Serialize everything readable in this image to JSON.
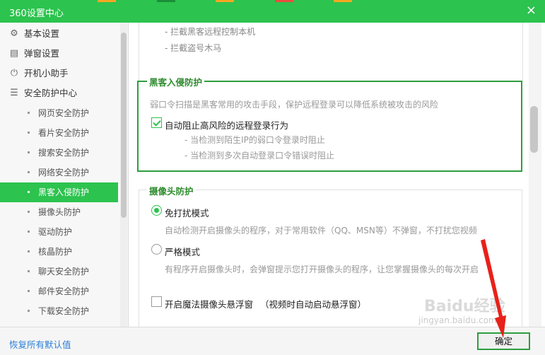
{
  "window": {
    "title": "360设置中心",
    "close_glyph": "×"
  },
  "colors": {
    "accent": "#2cc34e",
    "section_border": "#2e9e3e",
    "link": "#2c7fd6"
  },
  "sidebar": {
    "items": [
      {
        "label": "基本设置",
        "icon": "gear-icon",
        "glyph": "⚙"
      },
      {
        "label": "弹窗设置",
        "icon": "window-icon",
        "glyph": "▤"
      },
      {
        "label": "开机小助手",
        "icon": "power-icon",
        "glyph": "⏻"
      },
      {
        "label": "安全防护中心",
        "icon": "list-icon",
        "glyph": "☰"
      }
    ],
    "subitems": [
      {
        "label": "网页安全防护",
        "active": false
      },
      {
        "label": "看片安全防护",
        "active": false
      },
      {
        "label": "搜索安全防护",
        "active": false
      },
      {
        "label": "网络安全防护",
        "active": false
      },
      {
        "label": "黑客入侵防护",
        "active": true
      },
      {
        "label": "摄像头防护",
        "active": false
      },
      {
        "label": "驱动防护",
        "active": false
      },
      {
        "label": "核晶防护",
        "active": false
      },
      {
        "label": "聊天安全防护",
        "active": false
      },
      {
        "label": "邮件安全防护",
        "active": false
      },
      {
        "label": "下载安全防护",
        "active": false
      }
    ]
  },
  "content": {
    "prev_section": {
      "lines": [
        "- 拦截黑客远程控制本机",
        "- 拦截盗号木马"
      ]
    },
    "hacker": {
      "title": "黑客入侵防护",
      "desc": "弱口令扫描是黑客常用的攻击手段，保护远程登录可以降低系统被攻击的风险",
      "option": {
        "label": "自动阻止高风险的远程登录行为",
        "checked": true
      },
      "sub_lines": [
        "- 当检测到陌生IP的弱口令登录时阻止",
        "- 当检测到多次自动登录口令错误时阻止"
      ]
    },
    "camera": {
      "title": "摄像头防护",
      "mode1": {
        "label": "免打扰模式",
        "selected": true,
        "desc": "自动检测开启摄像头的程序，对于常用软件（QQ、MSN等）不弹窗，不打扰您视频"
      },
      "mode2": {
        "label": "严格模式",
        "selected": false,
        "desc": "有程序开启摄像头时，会弹窗提示您打开摄像头的程序，让您掌握摄像头的每次开启"
      },
      "magic": {
        "label": "开启魔法摄像头悬浮窗",
        "note": "（视频时自动启动悬浮窗）",
        "checked": false
      }
    }
  },
  "footer": {
    "restore": "恢复所有默认值",
    "ok": "确定"
  },
  "watermark": {
    "main": "Baidu经验",
    "sub": "jingyan.baidu.com"
  }
}
